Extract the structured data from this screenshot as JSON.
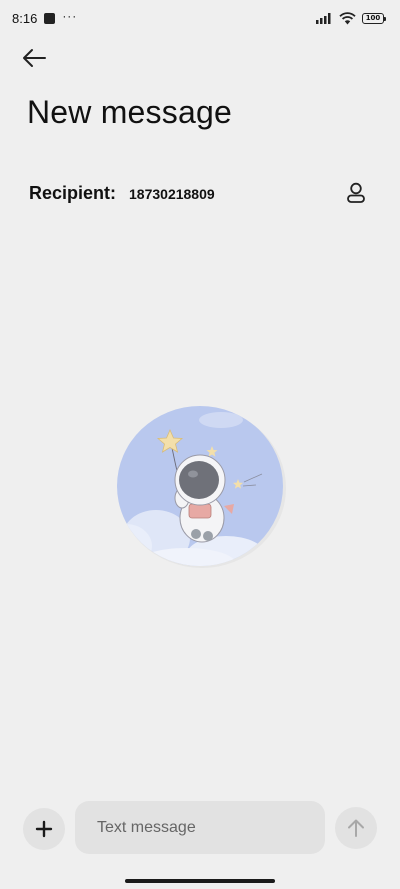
{
  "status_bar": {
    "time": "8:16",
    "more": "···",
    "battery": "100",
    "icons": [
      "notification-square-icon",
      "signal-icon",
      "wifi-icon",
      "battery-icon"
    ]
  },
  "header": {
    "back_icon": "arrow-left-icon",
    "title": "New message"
  },
  "recipient": {
    "label": "Recipient:",
    "number": "18730218809",
    "contact_icon": "person-icon"
  },
  "empty_state": {
    "image": "astronaut-illustration"
  },
  "composer": {
    "add_icon": "plus-icon",
    "placeholder": "Text message",
    "value": "",
    "send_icon": "arrow-up-icon"
  },
  "colors": {
    "background": "#efefef",
    "button_bg": "#e2e2e2",
    "illustration_sky": "#b9c8ee"
  }
}
